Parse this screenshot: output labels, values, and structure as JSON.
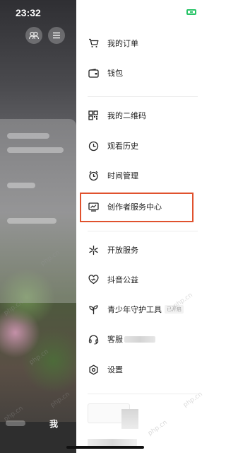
{
  "status_bar": {
    "time": "23:32"
  },
  "bottom_tab": {
    "me_label": "我"
  },
  "menu": {
    "items": [
      {
        "label": "我的订单",
        "icon": "cart-icon"
      },
      {
        "label": "钱包",
        "icon": "wallet-icon"
      },
      {
        "label": "我的二维码",
        "icon": "qrcode-icon"
      },
      {
        "label": "观看历史",
        "icon": "clock-icon"
      },
      {
        "label": "时间管理",
        "icon": "alarm-icon"
      },
      {
        "label": "创作者服务中心",
        "icon": "trend-chart-icon"
      },
      {
        "label": "开放服务",
        "icon": "asterisk-icon"
      },
      {
        "label": "抖音公益",
        "icon": "heart-icon"
      },
      {
        "label": "青少年守护工具",
        "icon": "sprout-icon",
        "badge": "已开启"
      },
      {
        "label": "客服",
        "icon": "headset-icon"
      },
      {
        "label": "设置",
        "icon": "hexagon-gear-icon"
      }
    ]
  },
  "watermark_text": "php.cn",
  "colors": {
    "highlight": "#e0522e",
    "battery": "#29c468"
  }
}
